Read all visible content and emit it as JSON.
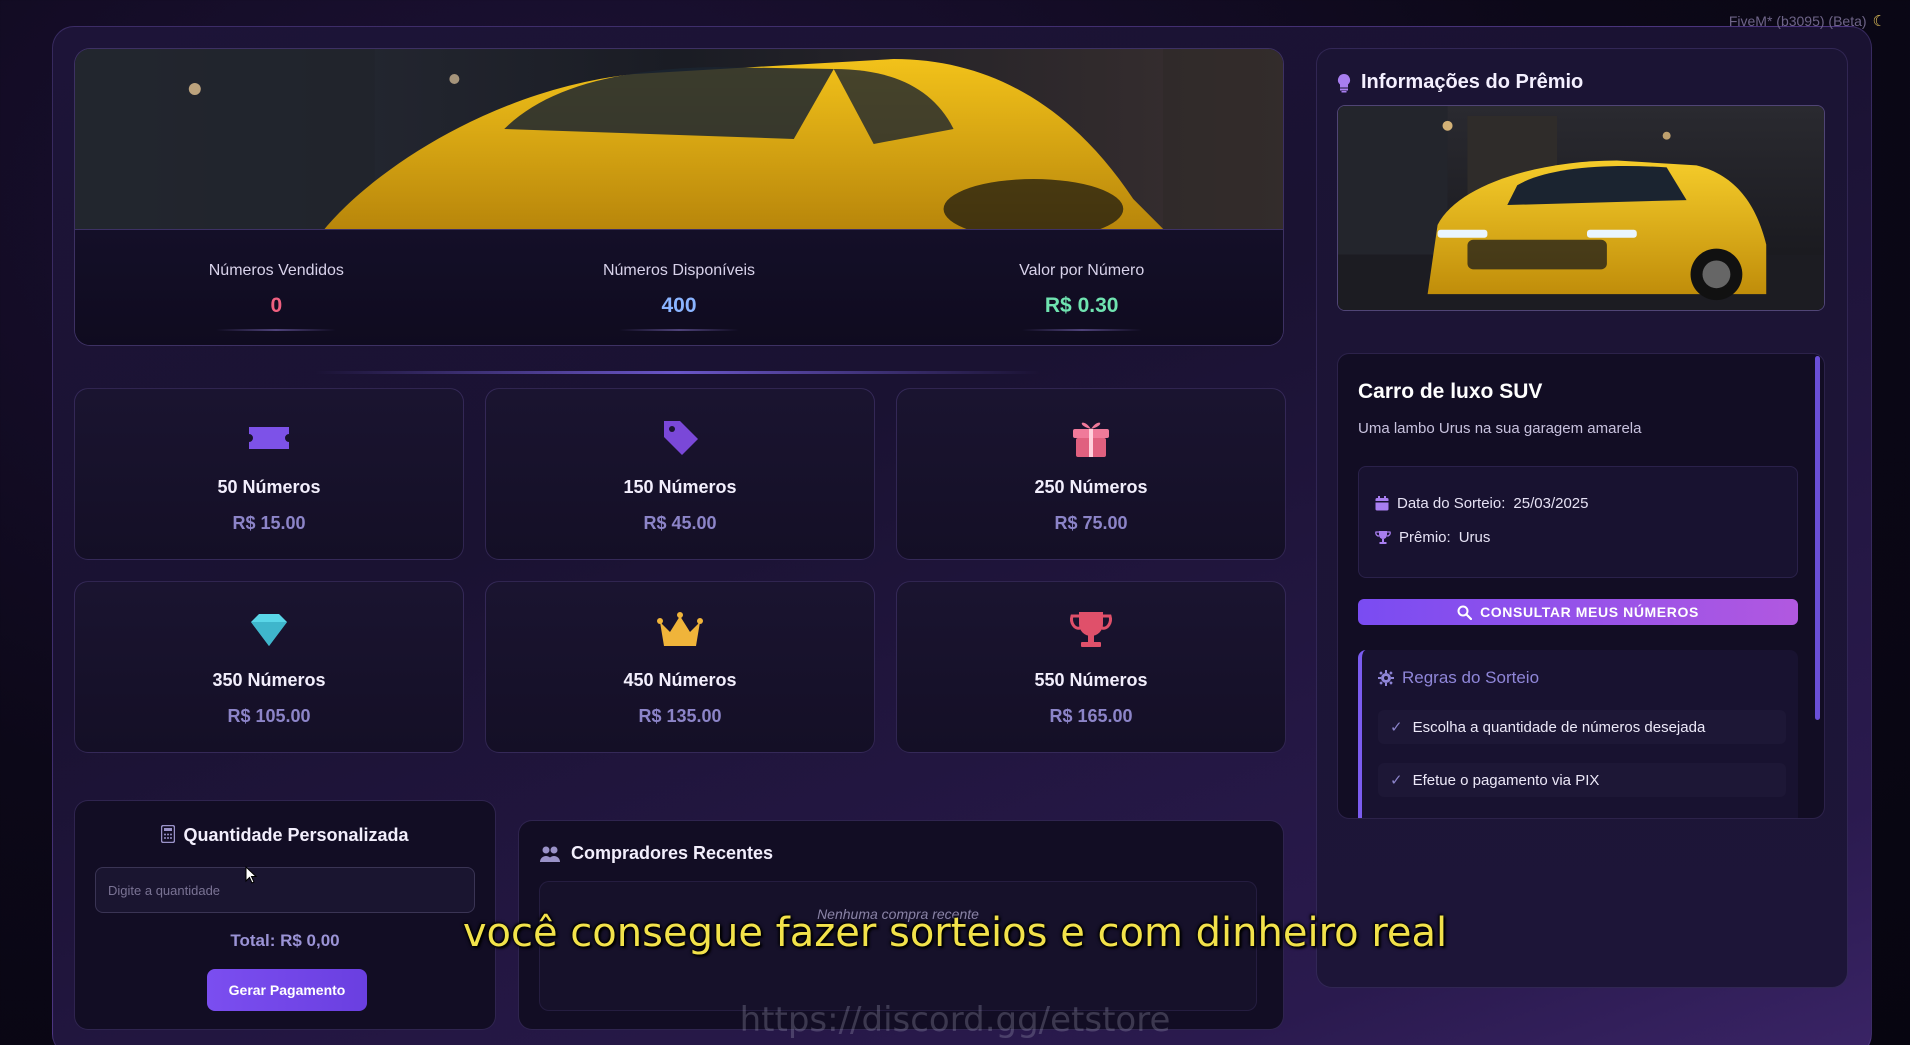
{
  "window": {
    "title": "FiveM* (b3095) (Beta)"
  },
  "stats": [
    {
      "label": "Números Vendidos",
      "value": "0",
      "color": "#f06080"
    },
    {
      "label": "Números Disponíveis",
      "value": "400",
      "color": "#8ab4ff"
    },
    {
      "label": "Valor por Número",
      "value": "R$ 0.30",
      "color": "#6fe3b0"
    }
  ],
  "packages": [
    {
      "icon": "ticket-icon",
      "title": "50 Números",
      "price": "R$ 15.00"
    },
    {
      "icon": "tag-icon",
      "title": "150 Números",
      "price": "R$ 45.00"
    },
    {
      "icon": "gift-icon",
      "title": "250 Números",
      "price": "R$ 75.00"
    },
    {
      "icon": "diamond-icon",
      "title": "350 Números",
      "price": "R$ 105.00"
    },
    {
      "icon": "crown-icon",
      "title": "450 Números",
      "price": "R$ 135.00"
    },
    {
      "icon": "trophy-icon",
      "title": "550 Números",
      "price": "R$ 165.00"
    }
  ],
  "custom": {
    "title": "Quantidade Personalizada",
    "placeholder": "Digite a quantidade",
    "total": "Total: R$ 0,00",
    "button": "Gerar Pagamento"
  },
  "recent": {
    "title": "Compradores Recentes",
    "empty": "Nenhuma compra recente"
  },
  "prize": {
    "section_title": "Informações do Prêmio",
    "name": "Carro de luxo SUV",
    "description": "Uma lambo Urus na sua garagem amarela",
    "draw_date_label": "Data do Sorteio:",
    "draw_date": "25/03/2025",
    "prize_label": "Prêmio:",
    "prize_value": "Urus",
    "consult_button": "CONSULTAR MEUS NÚMEROS"
  },
  "rules": {
    "title": "Regras do Sorteio",
    "items": [
      "Escolha a quantidade de números desejada",
      "Efetue o pagamento via PIX"
    ]
  },
  "overlay": {
    "subtitle": "você consegue fazer sorteios e com dinheiro real",
    "watermark": "https://discord.gg/etstore"
  },
  "colors": {
    "accent": "#7b4ef0",
    "price": "#8c84c8",
    "background": "#1a1232"
  }
}
